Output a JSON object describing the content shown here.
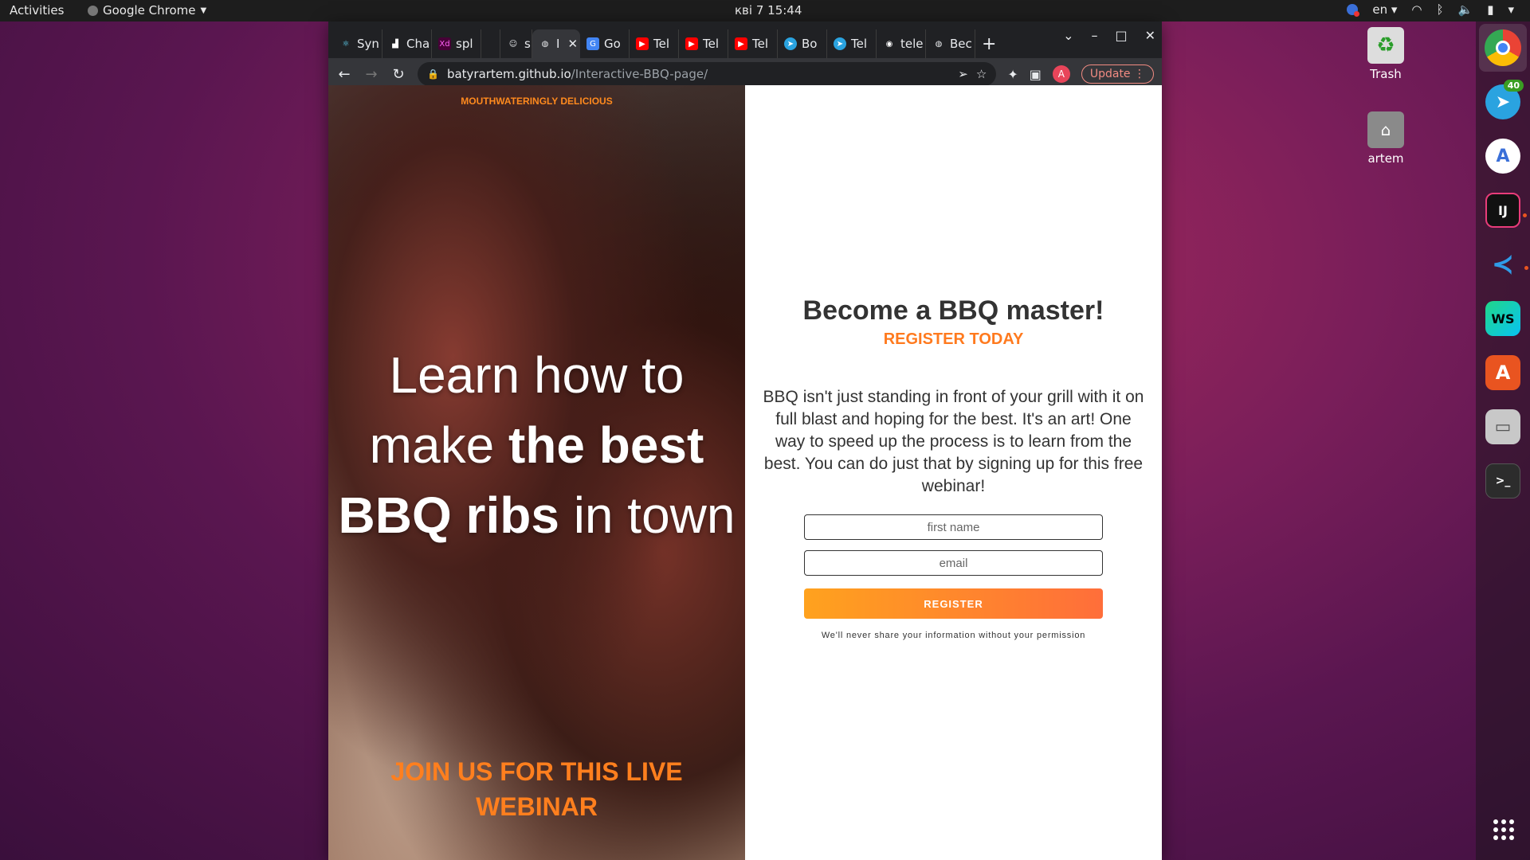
{
  "topbar": {
    "activities": "Activities",
    "app_name": "Google Chrome",
    "clock": "кві 7  15:44",
    "lang": "en"
  },
  "desktop": {
    "trash_label": "Trash",
    "home_label": "artem"
  },
  "dock": {
    "telegram_badge": "40"
  },
  "browser": {
    "tabs": [
      {
        "label": "Syn",
        "icon": "react-icon"
      },
      {
        "label": "Cha",
        "icon": "chart-icon"
      },
      {
        "label": "spl",
        "icon": "xd-icon"
      },
      {
        "label": "",
        "icon": "spacer"
      },
      {
        "label": "s",
        "icon": "cat-icon"
      },
      {
        "label": "I",
        "icon": "globe-icon",
        "active": true
      },
      {
        "label": "Go",
        "icon": "translate-icon"
      },
      {
        "label": "Tel",
        "icon": "youtube-icon"
      },
      {
        "label": "Tel",
        "icon": "youtube-icon"
      },
      {
        "label": "Tel",
        "icon": "youtube-icon"
      },
      {
        "label": "Bo",
        "icon": "telegram-icon"
      },
      {
        "label": "Tel",
        "icon": "telegram-icon"
      },
      {
        "label": "tele",
        "icon": "github-icon"
      },
      {
        "label": "Bec",
        "icon": "globe-icon"
      }
    ],
    "url_host": "batyrartem.github.io",
    "url_path": "/Interactive-BBQ-page/",
    "avatar_letter": "A",
    "update_label": "Update"
  },
  "hero": {
    "eyebrow": "MOUTHWATERINGLY DELICIOUS",
    "headline_1": "Learn how to",
    "headline_2a": "make ",
    "headline_2b": "the best",
    "headline_3a": "BBQ ribs",
    "headline_3b": " in town",
    "cta": "JOIN US FOR THIS LIVE WEBINAR"
  },
  "signup": {
    "title": "Become a BBQ master!",
    "subtitle": "REGISTER TODAY",
    "body": "BBQ isn't just standing in front of your grill with it on full blast and hoping for the best. It's an art! One way to speed up the process is to learn from the best. You can do just that by signing up for this free webinar!",
    "name_placeholder": "first name",
    "email_placeholder": "email",
    "button": "REGISTER",
    "disclaimer": "We'll never share your information without your permission"
  },
  "colors": {
    "accent": "#ff7a1e",
    "button_start": "#ffa21e",
    "button_end": "#ff6e3a"
  }
}
